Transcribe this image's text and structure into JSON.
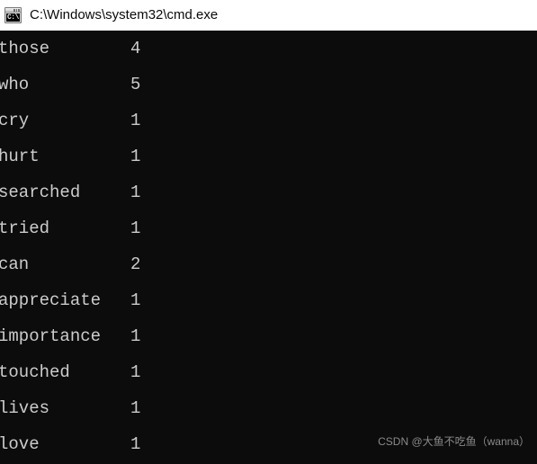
{
  "window": {
    "title": "C:\\Windows\\system32\\cmd.exe",
    "icon_name": "cmd-console-icon",
    "icon_glyph": "C:\\",
    "titlebar_background": "#ffffff",
    "titlebar_text_color": "#0a0a0a"
  },
  "console": {
    "background": "#0c0c0c",
    "foreground": "#cccccc",
    "rows": [
      {
        "word": "those",
        "count": "4"
      },
      {
        "word": "who",
        "count": "5"
      },
      {
        "word": "cry",
        "count": "1"
      },
      {
        "word": "hurt",
        "count": "1"
      },
      {
        "word": "searched",
        "count": "1"
      },
      {
        "word": "tried",
        "count": "1"
      },
      {
        "word": "can",
        "count": "2"
      },
      {
        "word": "appreciate",
        "count": "1"
      },
      {
        "word": "importance",
        "count": "1"
      },
      {
        "word": "touched",
        "count": "1"
      },
      {
        "word": "lives",
        "count": "1"
      },
      {
        "word": "love",
        "count": "1"
      }
    ]
  },
  "watermark": {
    "text": "CSDN @大鱼不吃鱼（wanna）",
    "color": "#8a8a8a"
  }
}
